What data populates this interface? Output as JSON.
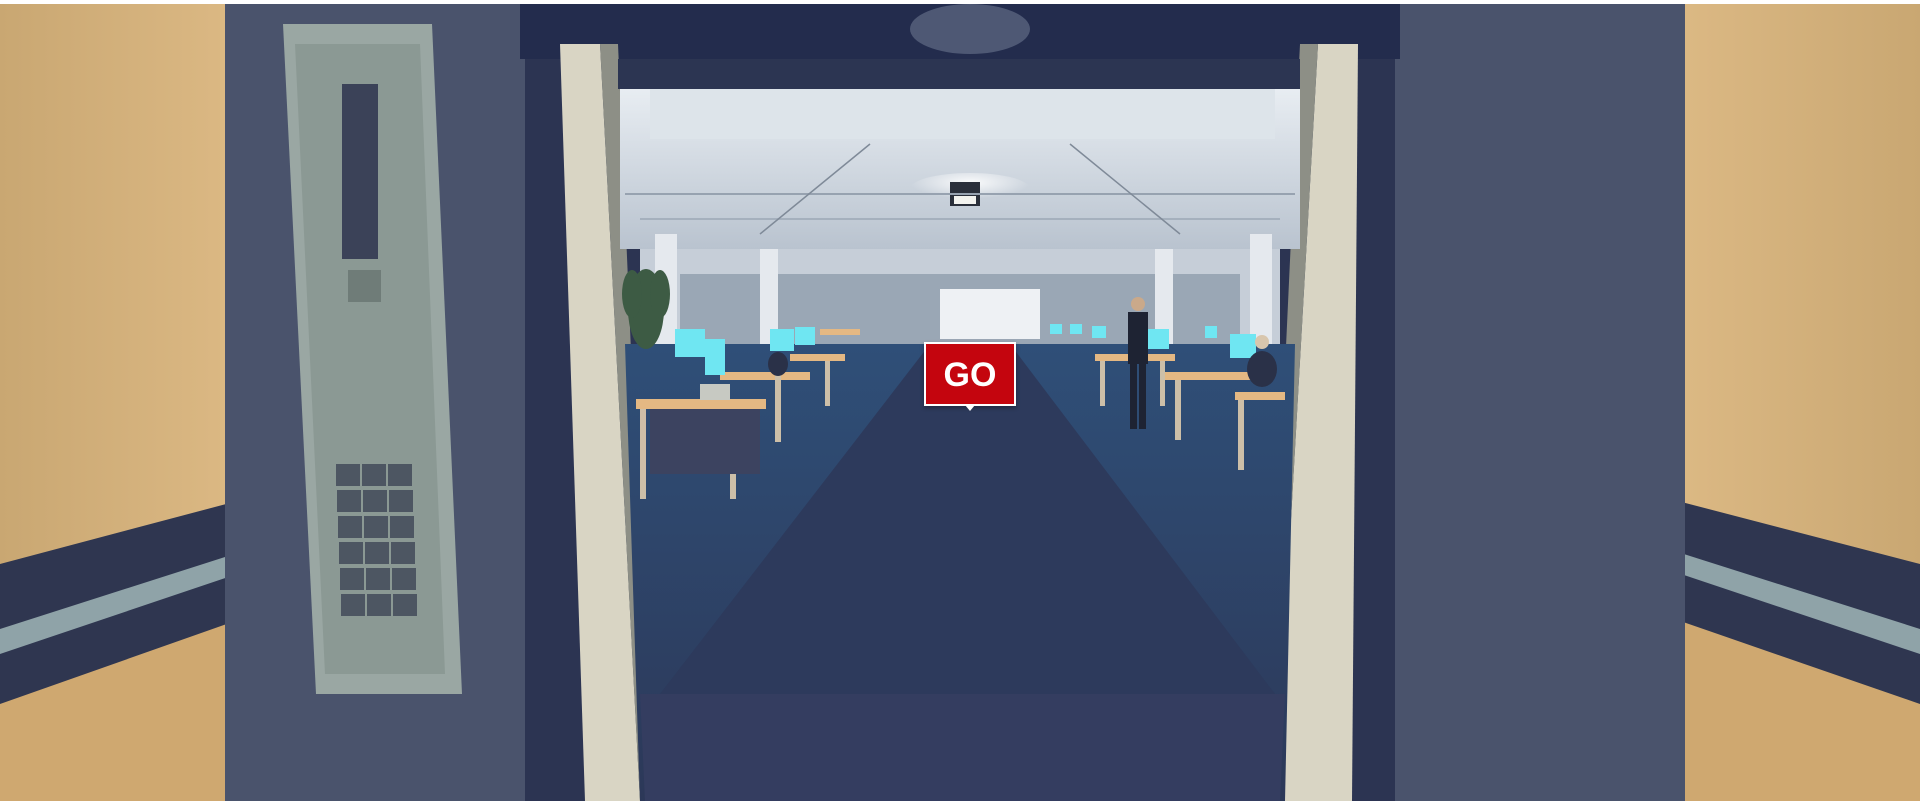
{
  "scene": {
    "description_icon": "elevator-view",
    "go_button": {
      "label": "GO"
    },
    "keypad_keys": 18,
    "colors": {
      "button_red": "#c4050e",
      "wall_tan": "#d8b47e",
      "carpet_blue": "#2e3a5c",
      "monitor_cyan": "#6fe6f2",
      "frame_slate": "#464f68"
    }
  }
}
